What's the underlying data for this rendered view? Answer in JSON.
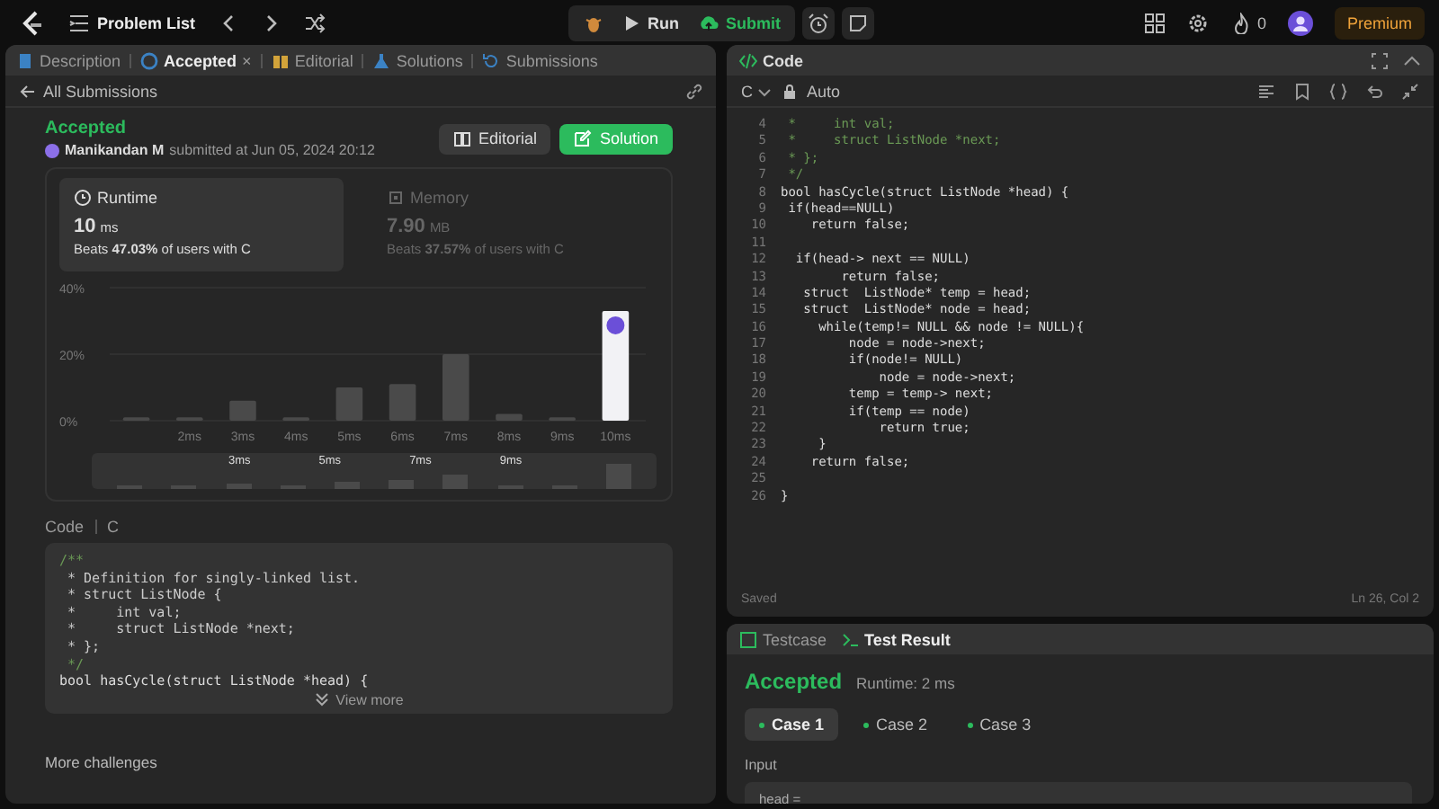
{
  "top_bar": {
    "problem_list": "Problem List",
    "run": "Run",
    "submit": "Submit",
    "streak": "0",
    "premium": "Premium"
  },
  "left_tabs": [
    {
      "label": "Description",
      "selected": false
    },
    {
      "label": "Accepted",
      "selected": true,
      "close": "×"
    },
    {
      "label": "Editorial",
      "selected": false
    },
    {
      "label": "Solutions",
      "selected": false
    },
    {
      "label": "Submissions",
      "selected": false
    }
  ],
  "back_link": "All Submissions",
  "submission": {
    "status": "Accepted",
    "user": "Manikandan M",
    "submitted": "submitted at Jun 05, 2024 20:12",
    "editorial_button": "Editorial",
    "solution_button": "Solution"
  },
  "stats": [
    {
      "title": "Runtime",
      "value": "10",
      "unit": "ms",
      "beats": "Beats **47.03%** of users with C",
      "selected": true
    },
    {
      "title": "Memory",
      "value": "7.90",
      "unit": "MB",
      "beats": "Beats **37.57%** of users with C",
      "selected": false
    }
  ],
  "runtime_chart": {
    "chart_data": {
      "type": "bar",
      "categories": [
        null,
        "2ms",
        "3ms",
        "4ms",
        "5ms",
        "6ms",
        "7ms",
        "8ms",
        "9ms",
        "10ms"
      ],
      "values": [
        1,
        1,
        6,
        1,
        10,
        11,
        20,
        2,
        1,
        33
      ],
      "ylim": [
        0,
        40
      ],
      "yticks": [
        {
          "value": 0,
          "label": "0%"
        },
        {
          "value": 20,
          "label": "20%"
        },
        {
          "value": 40,
          "label": "40%"
        }
      ]
    },
    "bars": [
      {
        "selected": false
      },
      {
        "selected": false
      },
      {
        "selected": false
      },
      {
        "selected": false
      },
      {
        "selected": false
      },
      {
        "selected": false
      },
      {
        "selected": false
      },
      {
        "selected": false
      },
      {
        "selected": false
      },
      {
        "selected": true
      }
    ],
    "navigator_labels": [
      "3ms",
      "5ms",
      "7ms",
      "9ms"
    ]
  },
  "code_section": {
    "label": "Code",
    "language": "C",
    "view_more": "View more",
    "more_challenges": "More challenges",
    "lines": [
      {
        "text": "/**",
        "kind": "comment"
      },
      {
        "text": " * Definition for singly-linked list.",
        "kind": "doc"
      },
      {
        "text": " * struct ListNode {",
        "kind": "doc"
      },
      {
        "text": " *     int val;",
        "kind": "doc"
      },
      {
        "text": " *     struct ListNode *next;",
        "kind": "doc"
      },
      {
        "text": " * };",
        "kind": "doc"
      },
      {
        "text": " */",
        "kind": "comment"
      },
      {
        "text": "bool hasCycle(struct ListNode *head) {",
        "kind": "code"
      }
    ]
  },
  "editor": {
    "title": "Code",
    "language": "C",
    "mode": "Auto",
    "saved": "Saved",
    "cursor": "Ln 26, Col 2",
    "lines": [
      {
        "no": "4",
        "text": " *     int val;",
        "kind": "comment"
      },
      {
        "no": "5",
        "text": " *     struct ListNode *next;",
        "kind": "comment"
      },
      {
        "no": "6",
        "text": " * };",
        "kind": "comment"
      },
      {
        "no": "7",
        "text": " */",
        "kind": "comment"
      },
      {
        "no": "8",
        "text": "bool hasCycle(struct ListNode *head) {",
        "kind": "code"
      },
      {
        "no": "9",
        "text": " if(head==NULL)",
        "kind": "code"
      },
      {
        "no": "10",
        "text": "    return false;",
        "kind": "code"
      },
      {
        "no": "11"
      },
      {
        "no": "12",
        "text": "  if(head-> next == NULL)",
        "kind": "code"
      },
      {
        "no": "13",
        "text": "        return false;",
        "kind": "code"
      },
      {
        "no": "14",
        "text": "   struct  ListNode* temp = head;",
        "kind": "code"
      },
      {
        "no": "15",
        "text": "   struct  ListNode* node = head;",
        "kind": "code"
      },
      {
        "no": "16",
        "text": "     while(temp!= NULL && node != NULL){",
        "kind": "code"
      },
      {
        "no": "17",
        "text": "         node = node->next;",
        "kind": "code"
      },
      {
        "no": "18",
        "text": "         if(node!= NULL)",
        "kind": "code"
      },
      {
        "no": "19",
        "text": "             node = node->next;",
        "kind": "code"
      },
      {
        "no": "20",
        "text": "         temp = temp-> next;",
        "kind": "code"
      },
      {
        "no": "21",
        "text": "         if(temp == node)",
        "kind": "code"
      },
      {
        "no": "22",
        "text": "             return true;",
        "kind": "code"
      },
      {
        "no": "23",
        "text": "     }",
        "kind": "code"
      },
      {
        "no": "24",
        "text": "    return false;",
        "kind": "code"
      },
      {
        "no": "25"
      },
      {
        "no": "26",
        "text": "}",
        "kind": "code"
      }
    ]
  },
  "test_tabs": [
    {
      "label": "Testcase",
      "selected": false
    },
    {
      "label": "Test Result",
      "selected": true
    }
  ],
  "result": {
    "status": "Accepted",
    "runtime": "Runtime: 2 ms",
    "cases": [
      {
        "label": "Case 1",
        "selected": true
      },
      {
        "label": "Case 2",
        "selected": false
      },
      {
        "label": "Case 3",
        "selected": false
      }
    ],
    "input_label": "Input",
    "input_value": "head ="
  }
}
